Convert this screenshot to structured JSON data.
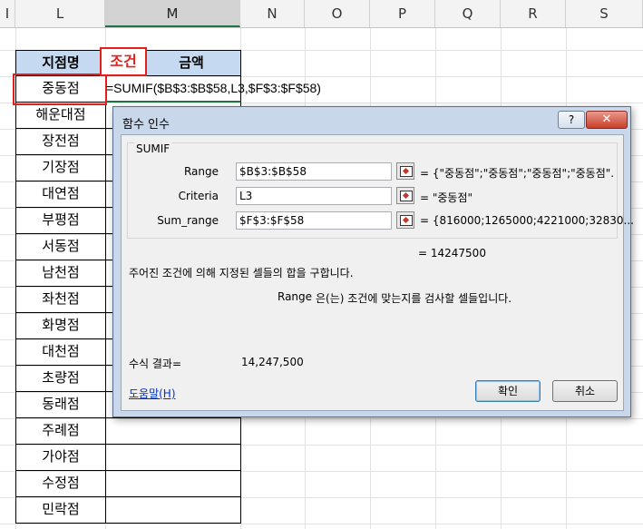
{
  "columns": [
    "I",
    "L",
    "M",
    "N",
    "O",
    "P",
    "Q",
    "R",
    "S"
  ],
  "selected_column": "M",
  "table": {
    "headers": [
      "지점명",
      "금액"
    ],
    "rows": [
      "중동점",
      "해운대점",
      "장전점",
      "기장점",
      "대연점",
      "부평점",
      "서동점",
      "남천점",
      "좌천점",
      "화명점",
      "대천점",
      "초량점",
      "동래점",
      "주례점",
      "가야점",
      "수정점",
      "민락점"
    ]
  },
  "condition_label": "조건",
  "formula": "=SUMIF($B$3:$B$58,L3,$F$3:$F$58)",
  "dialog": {
    "title": "함수 인수",
    "help_label": "?",
    "close_label": "✕",
    "function_name": "SUMIF",
    "args": [
      {
        "label": "Range",
        "value": "$B$3:$B$58",
        "result": "= {\"중동점\";\"중동점\";\"중동점\";\"중동점\"."
      },
      {
        "label": "Criteria",
        "value": "L3",
        "result": "= \"중동점\""
      },
      {
        "label": "Sum_range",
        "value": "$F$3:$F$58",
        "result": "= {816000;1265000;4221000;32830..."
      }
    ],
    "total_result": "=   14247500",
    "description": "주어진 조건에 의해 지정된 셀들의 합을 구합니다.",
    "arg_description_name": "Range",
    "arg_description": "은(는) 조건에 맞는지를 검사할 셀들입니다.",
    "formula_result_label": "수식 결과=",
    "formula_result_value": "14,247,500",
    "help_link": "도움말(H)",
    "ok_label": "확인",
    "cancel_label": "취소"
  }
}
